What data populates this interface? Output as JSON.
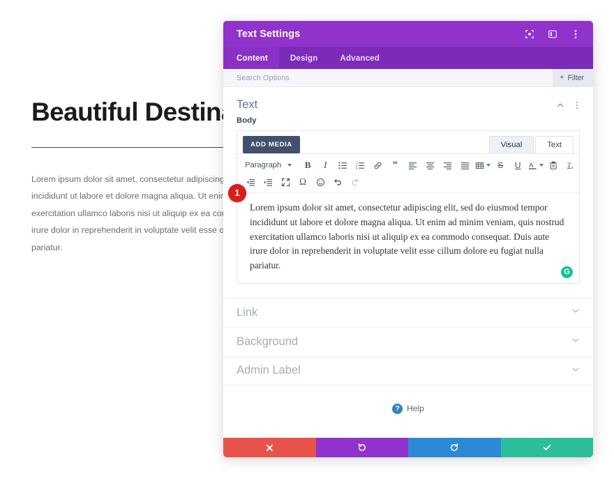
{
  "site": {
    "heading": "Beautiful Destination",
    "body": "Lorem ipsum dolor sit amet, consectetur adipiscing elit, sed do eiusmod tempor incididunt ut labore et dolore magna aliqua. Ut enim ad minim veniam, quis nostrud exercitation ullamco laboris nisi ut aliquip ex ea commodo consequat. Duis aute irure dolor in reprehenderit in voluptate velit esse cillum dolore eu fugiat nulla pariatur."
  },
  "modal": {
    "title": "Text Settings",
    "header_icons": [
      "target-icon",
      "panel-toggle-icon",
      "more-vertical-icon"
    ],
    "accent_color": "#8f33cc",
    "tabs": [
      {
        "label": "Content",
        "active": true
      },
      {
        "label": "Design",
        "active": false
      },
      {
        "label": "Advanced",
        "active": false
      }
    ],
    "search": {
      "placeholder": "Search Options",
      "value": "",
      "filter_label": "Filter",
      "filter_plus": "+"
    },
    "section": {
      "title": "Text",
      "collapse_icon": "chevron-up-icon",
      "menu_icon": "more-vertical-icon"
    },
    "field": {
      "label": "Body",
      "add_media_label": "ADD MEDIA",
      "editor_tabs": [
        {
          "label": "Visual",
          "active": true
        },
        {
          "label": "Text",
          "active": false
        }
      ],
      "format_select": "Paragraph",
      "toolbar_row1": [
        "bold-icon",
        "italic-icon",
        "bulleted-list-icon",
        "numbered-list-icon",
        "link-icon",
        "blockquote-icon",
        "align-left-icon",
        "align-center-icon",
        "align-right-icon",
        "align-justify-icon",
        "table-icon",
        "strikethrough-icon",
        "underline-icon",
        "text-color-icon",
        "paste-as-text-icon",
        "clear-formatting-icon"
      ],
      "toolbar_row2": [
        "outdent-icon",
        "indent-icon",
        "fullscreen-icon",
        "special-character-icon",
        "emoji-icon",
        "undo-icon",
        "redo-icon"
      ],
      "content": "Lorem ipsum dolor sit amet, consectetur adipiscing elit, sed do eiusmod tempor incididunt ut labore et dolore magna aliqua. Ut enim ad minim veniam, quis nostrud exercitation ullamco laboris nisi ut aliquip ex ea commodo consequat. Duis aute irure dolor in reprehenderit in voluptate velit esse cillum dolore eu fugiat nulla pariatur.",
      "badge_number": "1",
      "grammarly_letter": "G",
      "grammarly_color": "#15c39a",
      "badge_color": "#d91e18"
    },
    "accordion": [
      {
        "label": "Link",
        "icon": "chevron-down-icon"
      },
      {
        "label": "Background",
        "icon": "chevron-down-icon"
      },
      {
        "label": "Admin Label",
        "icon": "chevron-down-icon"
      }
    ],
    "help": {
      "label": "Help",
      "mark": "?"
    },
    "footer": [
      {
        "name": "discard-button",
        "icon": "close-icon",
        "color": "#e8534c"
      },
      {
        "name": "undo-button",
        "icon": "undo-icon",
        "color": "#8f33cc"
      },
      {
        "name": "redo-button",
        "icon": "redo-icon",
        "color": "#2d89d4"
      },
      {
        "name": "save-button",
        "icon": "check-icon",
        "color": "#2dbd9b"
      }
    ]
  }
}
